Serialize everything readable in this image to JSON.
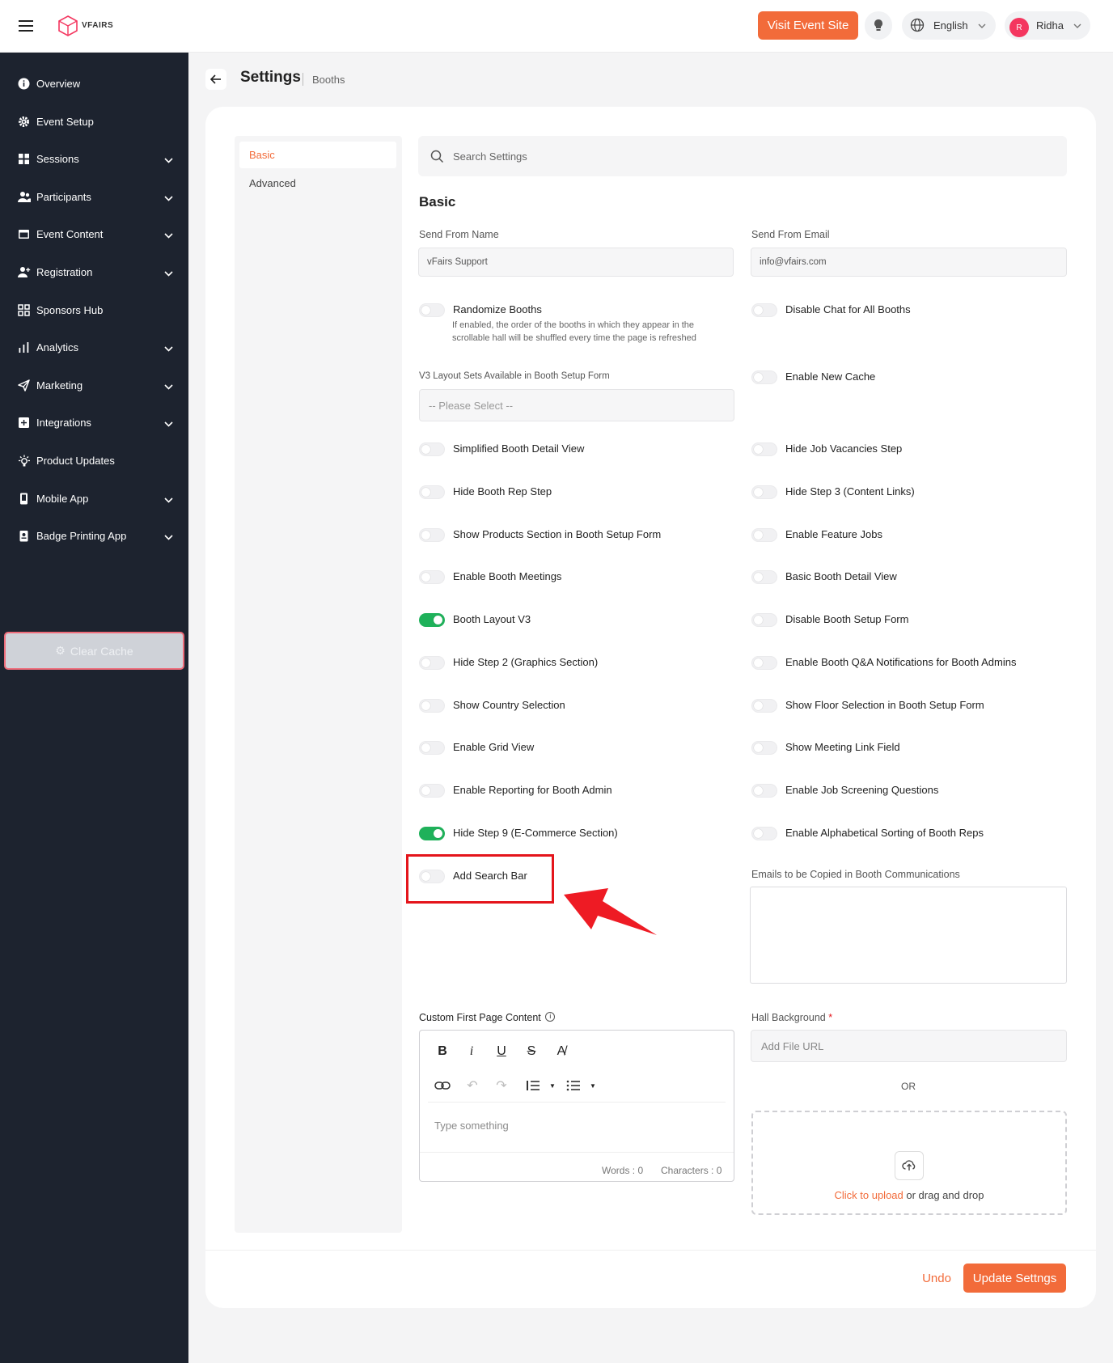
{
  "header": {
    "logo_text": "VFAIRS",
    "visit_button": "Visit Event Site",
    "language": "English",
    "user_initial": "R",
    "user_name": "Ridha"
  },
  "sidebar": {
    "items": [
      {
        "label": "Overview",
        "icon": "info-icon",
        "expandable": false
      },
      {
        "label": "Event Setup",
        "icon": "gear-icon",
        "expandable": false
      },
      {
        "label": "Sessions",
        "icon": "grid-icon",
        "expandable": true
      },
      {
        "label": "Participants",
        "icon": "users-icon",
        "expandable": true
      },
      {
        "label": "Event Content",
        "icon": "window-icon",
        "expandable": true
      },
      {
        "label": "Registration",
        "icon": "user-plus-icon",
        "expandable": true
      },
      {
        "label": "Sponsors Hub",
        "icon": "squares-icon",
        "expandable": false
      },
      {
        "label": "Analytics",
        "icon": "bar-chart-icon",
        "expandable": true
      },
      {
        "label": "Marketing",
        "icon": "send-icon",
        "expandable": true
      },
      {
        "label": "Integrations",
        "icon": "plus-box-icon",
        "expandable": true
      },
      {
        "label": "Product Updates",
        "icon": "bulb-icon",
        "expandable": false
      },
      {
        "label": "Mobile App",
        "icon": "mobile-icon",
        "expandable": true
      },
      {
        "label": "Badge Printing App",
        "icon": "badge-icon",
        "expandable": true
      }
    ],
    "clear_cache": "Clear Cache"
  },
  "page": {
    "title": "Settings",
    "breadcrumb": "Booths"
  },
  "settings_nav": {
    "basic": "Basic",
    "advanced": "Advanced"
  },
  "search": {
    "placeholder": "Search Settings"
  },
  "section_title": "Basic",
  "fields": {
    "send_from_name_label": "Send From Name",
    "send_from_name_value": "vFairs Support",
    "send_from_email_label": "Send From Email",
    "send_from_email_value": "info@vfairs.com",
    "layout_sets_label": "V3 Layout Sets Available in Booth Setup Form",
    "layout_sets_placeholder": "-- Please Select --",
    "emails_copied_label": "Emails to be Copied in Booth Communications",
    "custom_content_label": "Custom First Page Content",
    "hall_bg_label": "Hall Background",
    "hall_bg_required": "*",
    "file_url_placeholder": "Add File URL",
    "or_text": "OR",
    "upload_link": "Click to upload",
    "upload_rest": " or drag and drop"
  },
  "randomize_desc": "If enabled, the order of the booths in which they appear in the scrollable hall will be shuffled every time the page is refreshed",
  "toggles_left": [
    {
      "label": "Randomize Booths",
      "on": false
    },
    {
      "label": "Simplified Booth Detail View",
      "on": false
    },
    {
      "label": "Hide Booth Rep Step",
      "on": false
    },
    {
      "label": "Show Products Section in Booth Setup Form",
      "on": false
    },
    {
      "label": "Enable Booth Meetings",
      "on": false
    },
    {
      "label": "Booth Layout V3",
      "on": true
    },
    {
      "label": "Hide Step 2 (Graphics Section)",
      "on": false
    },
    {
      "label": "Show Country Selection",
      "on": false
    },
    {
      "label": "Enable Grid View",
      "on": false
    },
    {
      "label": "Enable Reporting for Booth Admin",
      "on": false
    },
    {
      "label": "Hide Step 9 (E-Commerce Section)",
      "on": true
    },
    {
      "label": "Add Search Bar",
      "on": false
    }
  ],
  "toggles_right": [
    {
      "label": "Disable Chat for All Booths",
      "on": false
    },
    {
      "label": "Enable New Cache",
      "on": false
    },
    {
      "label": "Hide Job Vacancies Step",
      "on": false
    },
    {
      "label": "Hide Step 3 (Content Links)",
      "on": false
    },
    {
      "label": "Enable Feature Jobs",
      "on": false
    },
    {
      "label": "Basic Booth Detail View",
      "on": false
    },
    {
      "label": "Disable Booth Setup Form",
      "on": false
    },
    {
      "label": "Enable Booth Q&A Notifications for Booth Admins",
      "on": false
    },
    {
      "label": "Show Floor Selection in Booth Setup Form",
      "on": false
    },
    {
      "label": "Show Meeting Link Field",
      "on": false
    },
    {
      "label": "Enable Job Screening Questions",
      "on": false
    },
    {
      "label": "Enable Alphabetical Sorting of Booth Reps",
      "on": false
    }
  ],
  "editor": {
    "placeholder": "Type something",
    "words": "Words : 0",
    "characters": "Characters : 0"
  },
  "footer": {
    "undo": "Undo",
    "update": "Update Settngs"
  },
  "colors": {
    "accent": "#f26b3a",
    "sidebar_bg": "#1d232f",
    "toggle_on": "#1fb15a",
    "highlight": "#e4151b"
  }
}
